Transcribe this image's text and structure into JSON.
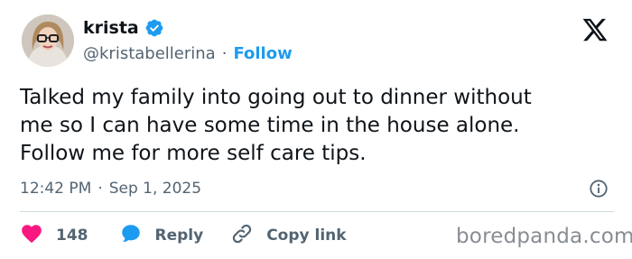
{
  "author": {
    "display_name": "krista",
    "handle": "@kristabellerina",
    "follow_label": "Follow",
    "separator": "·",
    "verified_icon": "verified-badge-icon"
  },
  "tweet": {
    "line1": "Talked my family into going out to dinner without",
    "line2": "me so I can have some time in the house alone.",
    "line3": "Follow me for more self care tips."
  },
  "meta": {
    "time": "12:42 PM",
    "separator": "·",
    "date": "Sep 1, 2025"
  },
  "actions": {
    "like_count": "148",
    "reply_label": "Reply",
    "copy_label": "Copy link"
  },
  "watermark": "boredpanda.com",
  "colors": {
    "accent": "#1d9bf0",
    "like": "#f91880",
    "muted_text": "#536471",
    "text": "#0f1419"
  }
}
